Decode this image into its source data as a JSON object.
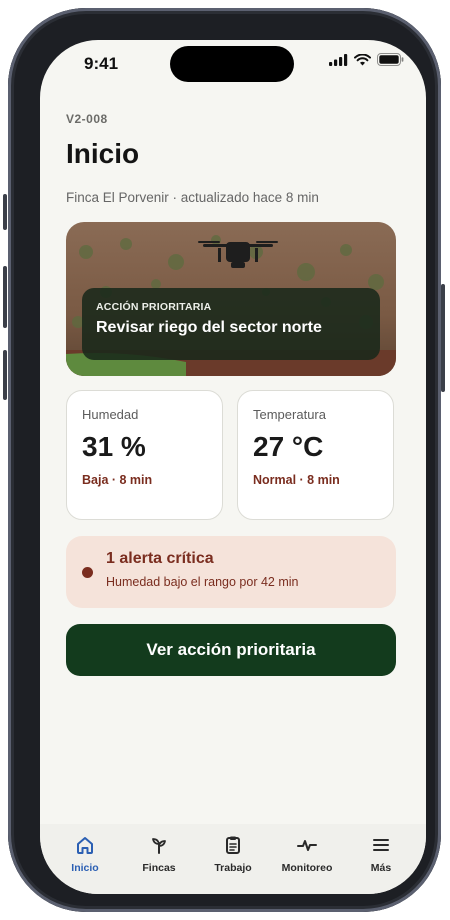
{
  "status_bar": {
    "time": "9:41"
  },
  "header": {
    "version": "V2-008",
    "title": "Inicio",
    "subtitle": "Finca El Porvenir · actualizado hace 8 min"
  },
  "hero": {
    "kicker": "ACCIÓN PRIORITARIA",
    "text": "Revisar riego del sector norte"
  },
  "metrics": [
    {
      "label": "Humedad",
      "value": "31 %",
      "note": "Baja · 8 min"
    },
    {
      "label": "Temperatura",
      "value": "27 °C",
      "note": "Normal · 8 min"
    }
  ],
  "alert": {
    "title": "1 alerta crítica",
    "text": "Humedad bajo el rango por 42 min"
  },
  "cta": {
    "label": "Ver acción prioritaria"
  },
  "tabs": [
    {
      "label": "Inicio",
      "icon": "home-icon",
      "active": true
    },
    {
      "label": "Fincas",
      "icon": "sprout-icon"
    },
    {
      "label": "Trabajo",
      "icon": "clipboard-icon"
    },
    {
      "label": "Monitoreo",
      "icon": "pulse-icon"
    },
    {
      "label": "Más",
      "icon": "menu-icon"
    }
  ],
  "colors": {
    "accent": "#2b5fb3",
    "primary_dark_green": "#133b1d",
    "alert_bg": "#f5e3da",
    "alert_text": "#7a2d1f",
    "background": "#f6f6f2"
  }
}
